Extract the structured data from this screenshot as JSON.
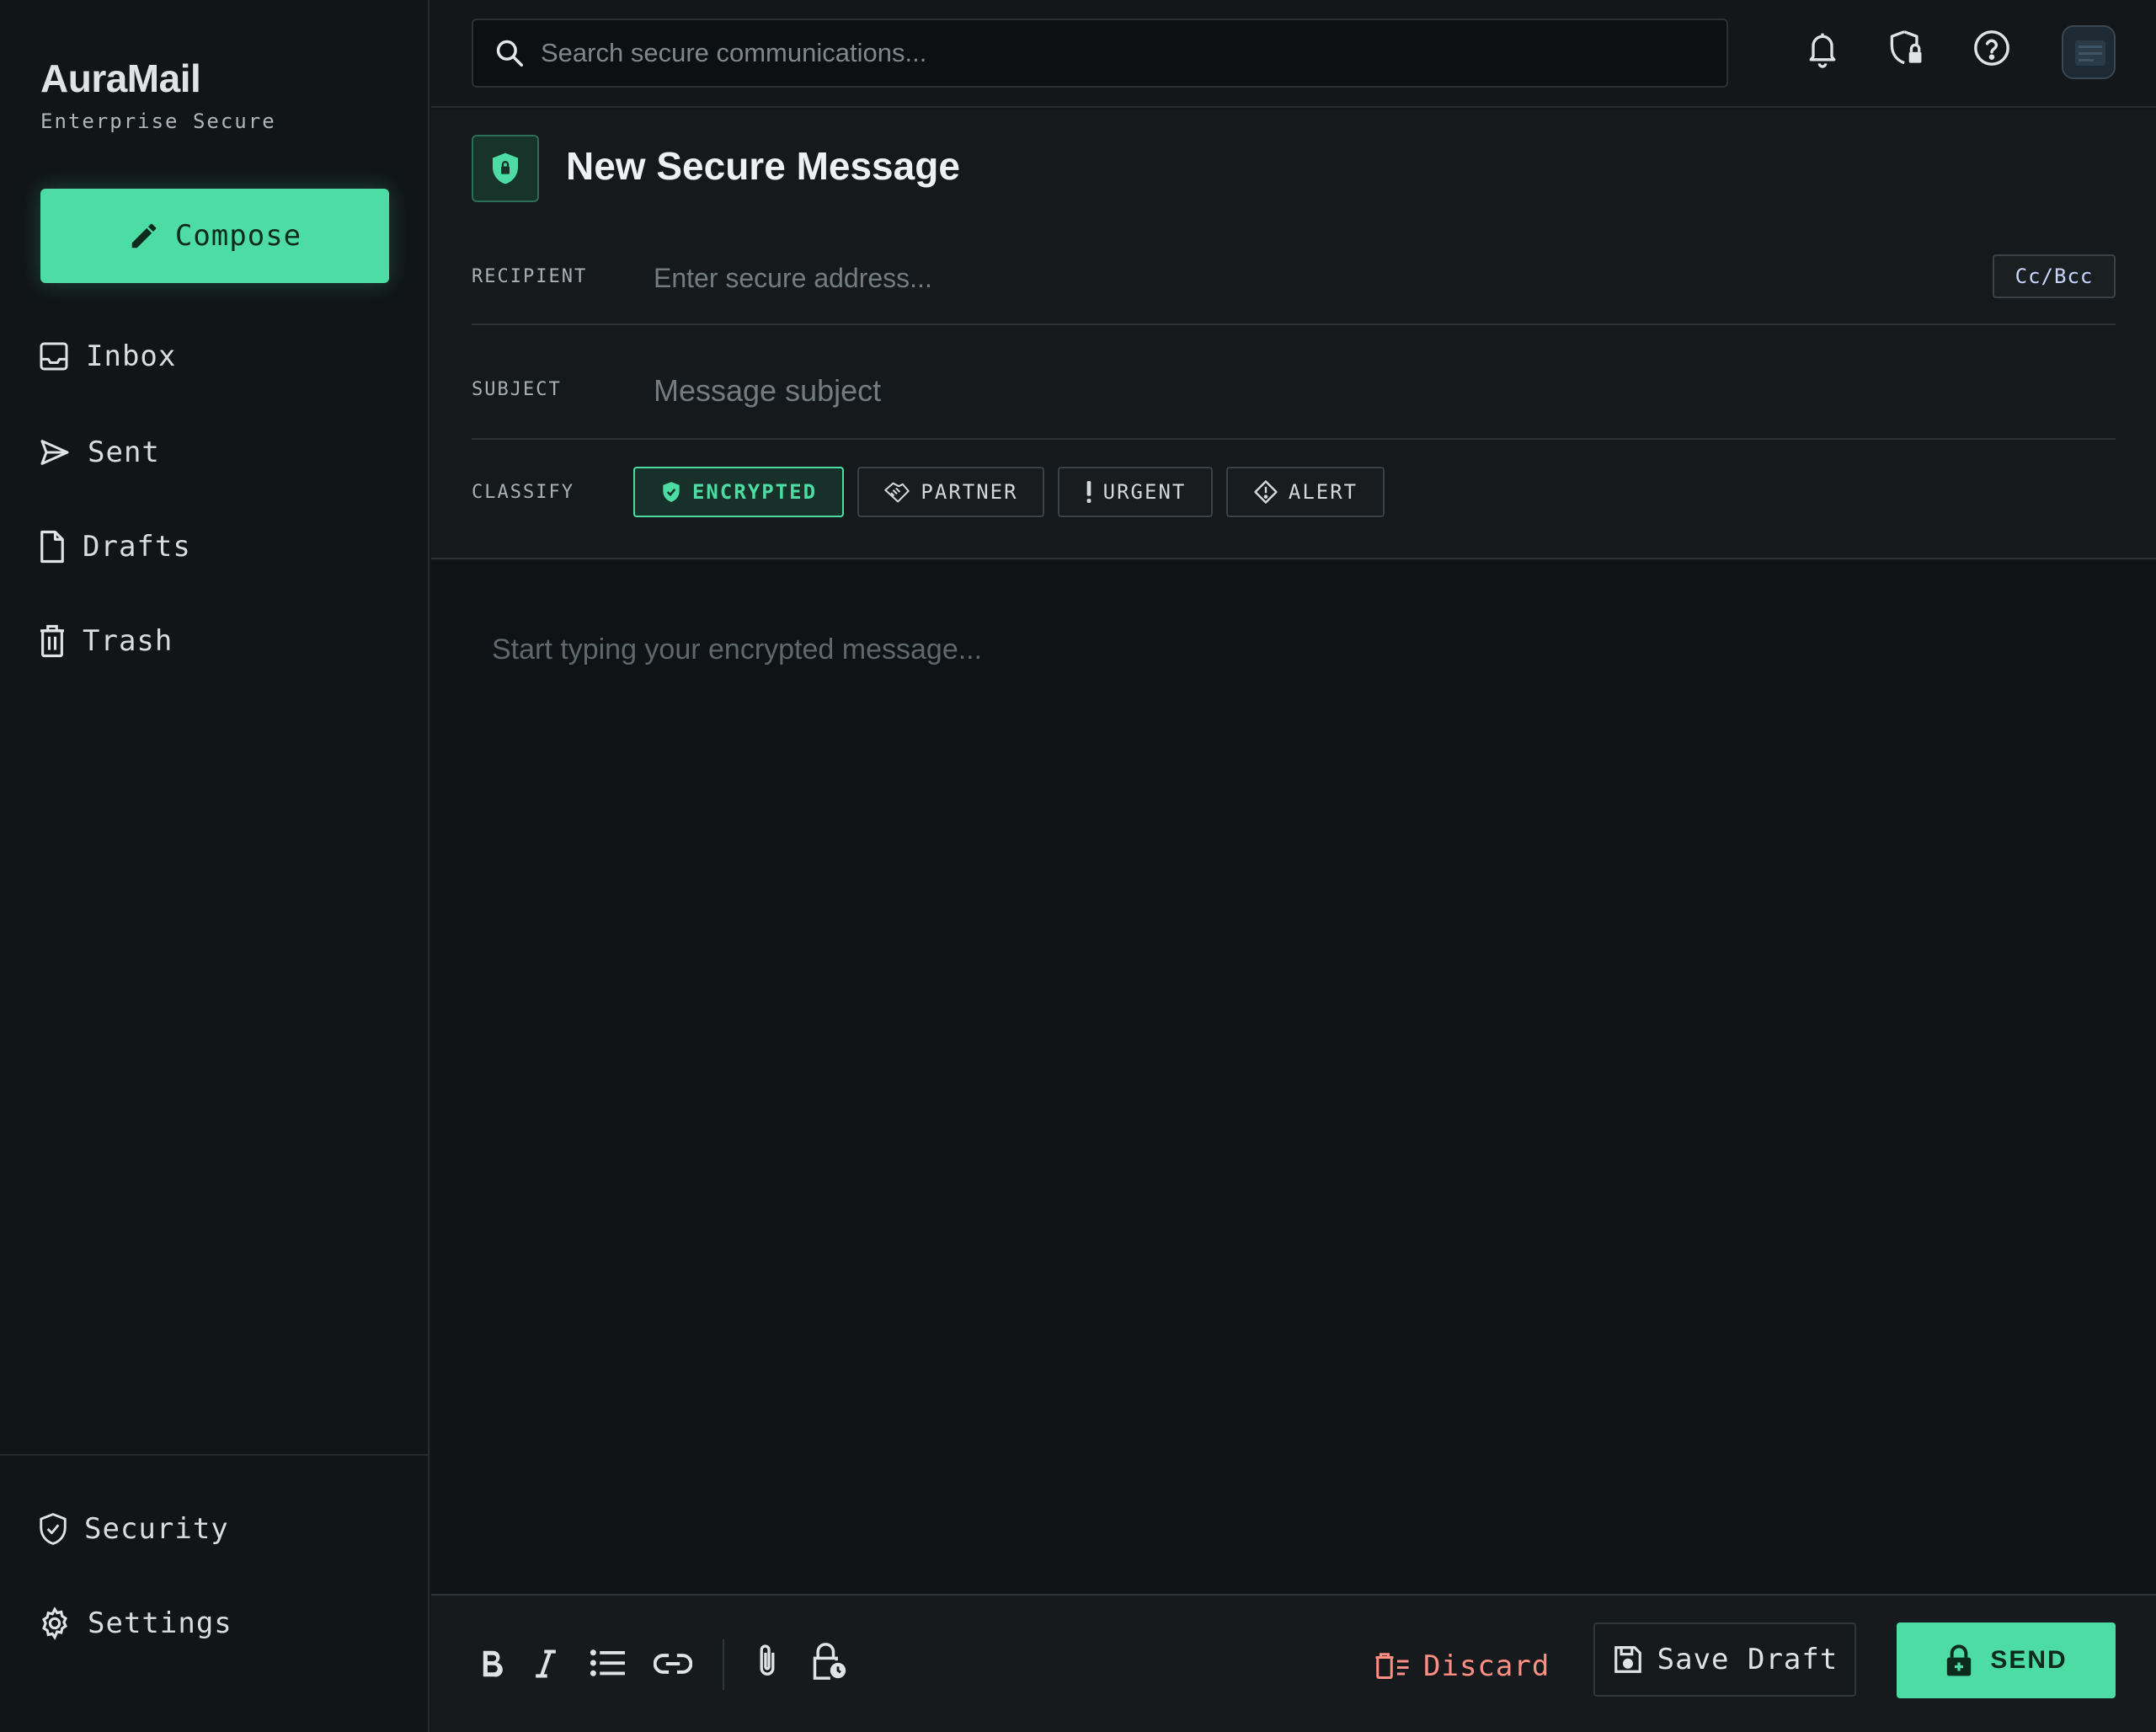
{
  "app": {
    "name": "AuraMail",
    "tagline": "Enterprise Secure"
  },
  "sidebar": {
    "compose_label": "Compose",
    "items": [
      {
        "label": "Inbox",
        "icon": "inbox-icon"
      },
      {
        "label": "Sent",
        "icon": "send-arrow-icon"
      },
      {
        "label": "Drafts",
        "icon": "document-icon"
      },
      {
        "label": "Trash",
        "icon": "trash-icon"
      }
    ],
    "bottom_items": [
      {
        "label": "Security",
        "icon": "shield-check-icon"
      },
      {
        "label": "Settings",
        "icon": "gear-icon"
      }
    ]
  },
  "topbar": {
    "search_placeholder": "Search secure communications...",
    "icons": [
      "bell-icon",
      "shield-lock-icon",
      "help-icon",
      "avatar"
    ]
  },
  "composer": {
    "title": "New Secure Message",
    "recipient_label": "RECIPIENT",
    "recipient_placeholder": "Enter secure address...",
    "recipient_value": "",
    "cc_bcc_label": "Cc/Bcc",
    "subject_label": "SUBJECT",
    "subject_placeholder": "Message subject",
    "subject_value": "",
    "classify_label": "CLASSIFY",
    "tags": [
      {
        "label": "ENCRYPTED",
        "icon": "shield-check-icon",
        "active": true
      },
      {
        "label": "PARTNER",
        "icon": "handshake-icon",
        "active": false
      },
      {
        "label": "URGENT",
        "icon": "exclamation-icon",
        "active": false
      },
      {
        "label": "ALERT",
        "icon": "diamond-alert-icon",
        "active": false
      }
    ],
    "body_placeholder": "Start typing your encrypted message...",
    "body_value": ""
  },
  "toolbar": {
    "format_icons": [
      "bold-icon",
      "italic-icon",
      "list-icon",
      "link-icon",
      "attachment-icon",
      "timed-lock-icon"
    ],
    "discard_label": "Discard",
    "save_draft_label": "Save Draft",
    "send_label": "SEND"
  },
  "colors": {
    "accent": "#4ddca3",
    "background": "#121618",
    "danger": "#ff8f83"
  }
}
